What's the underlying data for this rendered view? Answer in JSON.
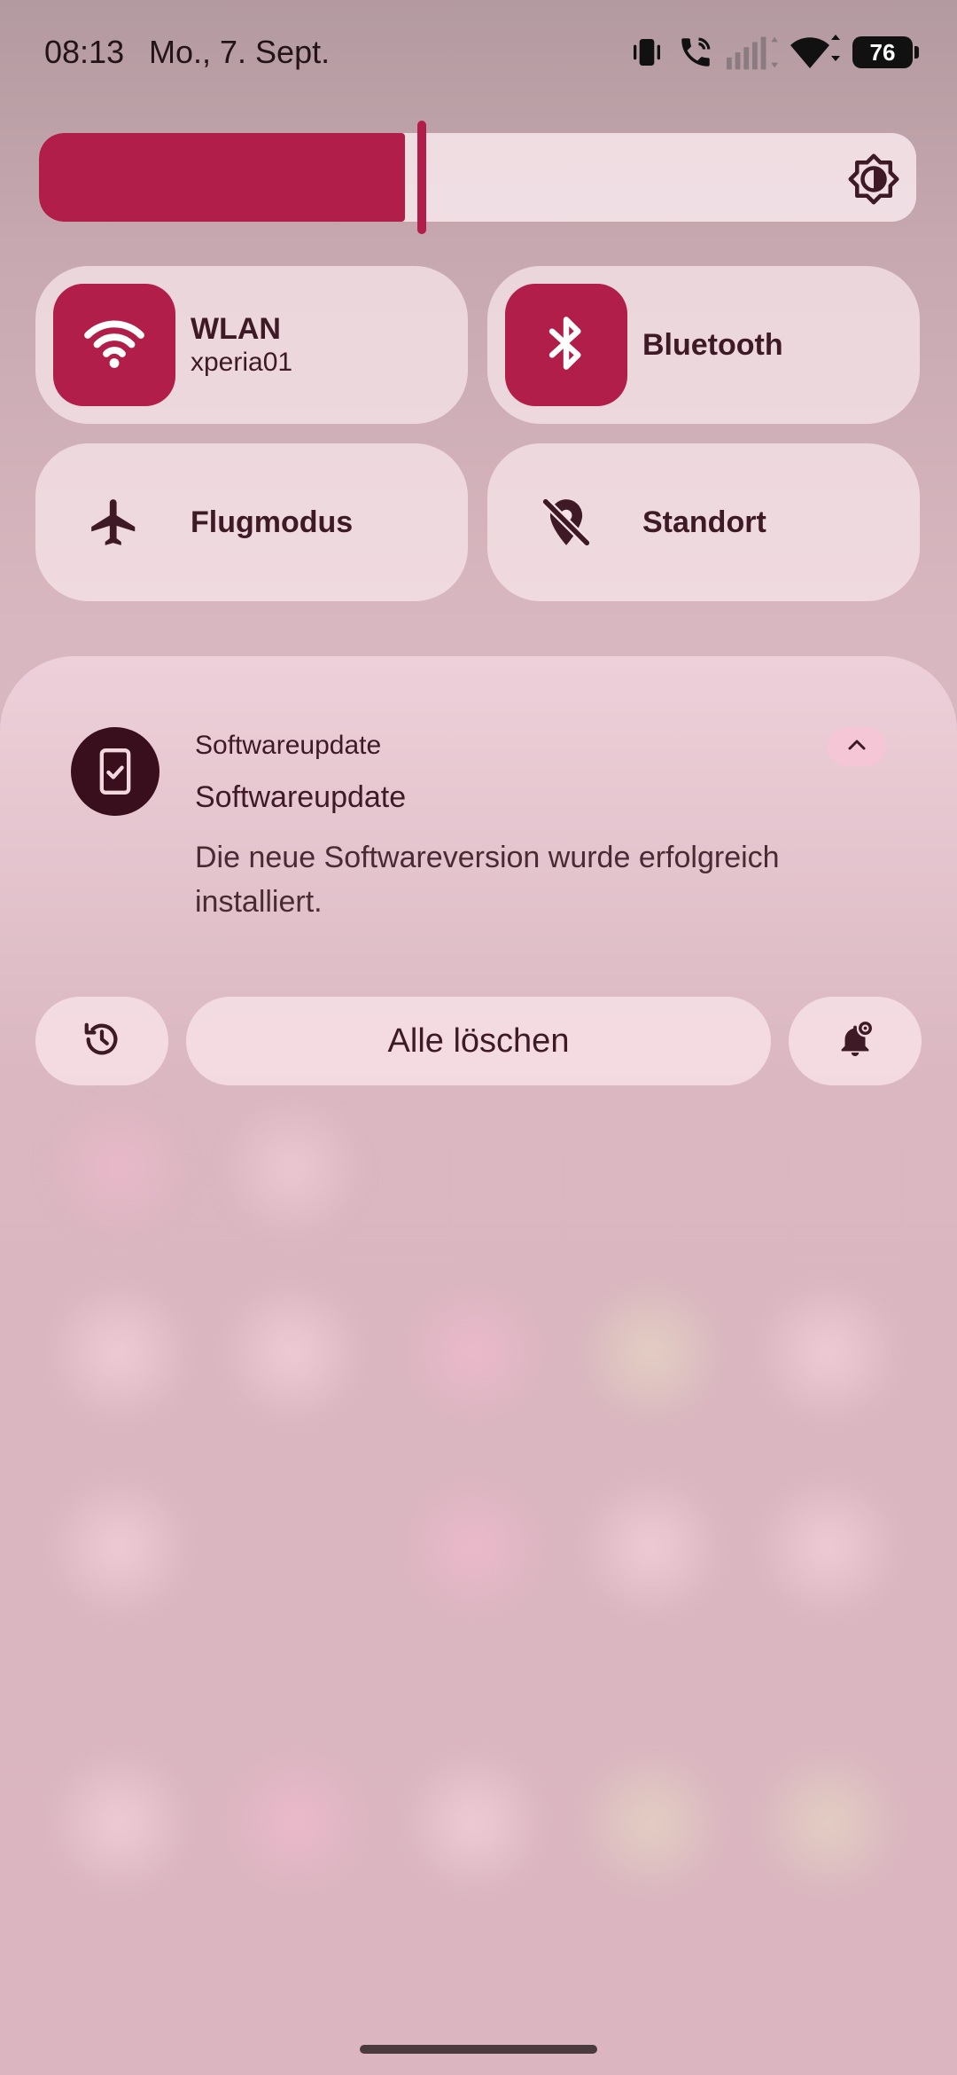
{
  "status_bar": {
    "time": "08:13",
    "date": "Mo., 7. Sept.",
    "battery": "76",
    "icons": [
      "vibrate-icon",
      "wifi-calling-icon",
      "cellular-signal-icon",
      "wifi-icon",
      "battery-icon"
    ]
  },
  "brightness": {
    "level": 0.435,
    "icon": "brightness-icon"
  },
  "tiles": [
    {
      "label": "WLAN",
      "sublabel": "xperia01",
      "icon": "wifi-icon",
      "active": true
    },
    {
      "label": "Bluetooth",
      "icon": "bluetooth-icon",
      "active": true
    },
    {
      "label": "Flugmodus",
      "icon": "airplane-icon",
      "active": false
    },
    {
      "label": "Standort",
      "icon": "location-off-icon",
      "active": false
    }
  ],
  "notification": {
    "app_name": "Softwareupdate",
    "title": "Softwareupdate",
    "body": "Die neue Softwareversion wurde erfolgreich installiert.",
    "icon": "phone-check-icon",
    "expand_icon": "chevron-up-icon"
  },
  "actions": {
    "history_icon": "history-icon",
    "clear_all_label": "Alle löschen",
    "settings_icon": "notification-settings-icon"
  },
  "colors": {
    "accent": "#b01e49",
    "text": "#3e1a26",
    "icon_dark": "#3a0f1d"
  }
}
